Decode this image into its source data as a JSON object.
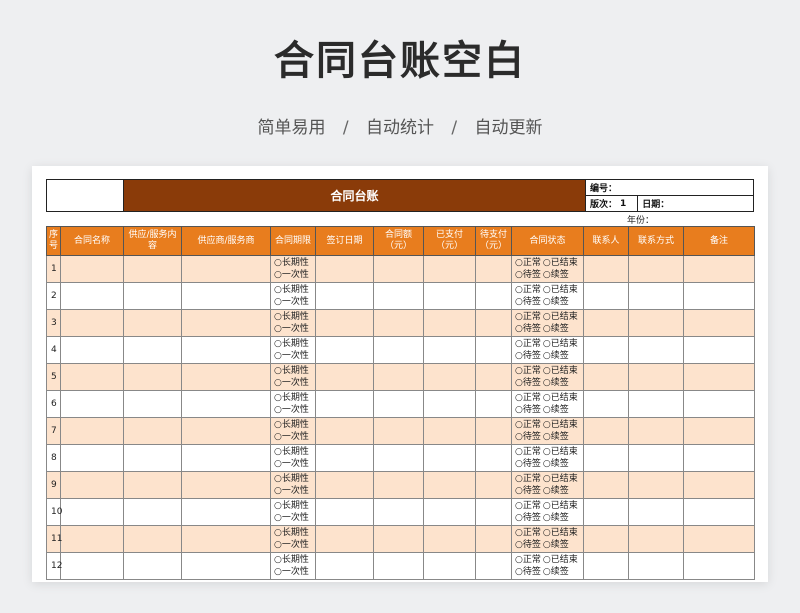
{
  "page": {
    "title": "合同台账空白",
    "features": [
      "简单易用",
      "自动统计",
      "自动更新"
    ],
    "separator": "/"
  },
  "sheet": {
    "title": "合同台账",
    "code_label": "编号：",
    "version_label": "版次：",
    "version_value": "1",
    "date_label": "日期：",
    "year_label": "年份："
  },
  "columns": [
    "序号",
    "合同名称",
    "供应/服务内容",
    "供应商/服务商",
    "合同期限",
    "签订日期",
    "合同额（元）",
    "已支付（元）",
    "待支付（元）",
    "合同状态",
    "联系人",
    "联系方式",
    "备注"
  ],
  "term_options": [
    "○长期性",
    "○一次性"
  ],
  "status_options": [
    [
      "○正常",
      "○已结束"
    ],
    [
      "○待签",
      "○续签"
    ]
  ],
  "rows": [
    "1",
    "2",
    "3",
    "4",
    "5",
    "6",
    "7",
    "8",
    "9",
    "10",
    "11",
    "12"
  ],
  "colors": {
    "header_dark": "#8a3b09",
    "header_orange": "#e87d1e",
    "row_stripe": "#fde3cd",
    "background": "#eeeff1"
  }
}
